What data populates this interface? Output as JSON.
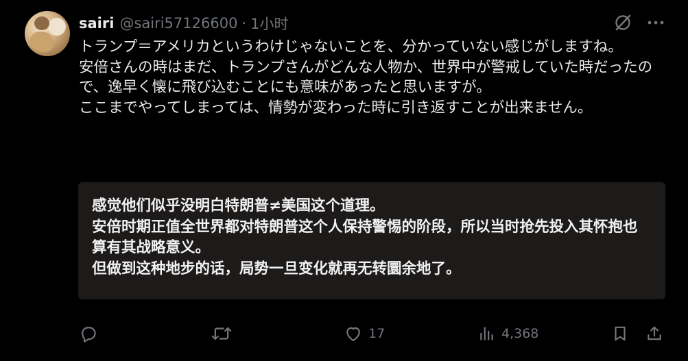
{
  "post": {
    "display_name": "sairi",
    "handle": "@sairi57126600",
    "separator": "·",
    "time": "1小时",
    "lines": [
      "トランプ＝アメリカというわけじゃないことを、分かっていない感じがしますね。",
      "安倍さんの時はまだ、トランプさんがどんな人物か、世界中が警戒していた時だったので、逸早く懐に飛び込むことにも意味があったと思いますが。",
      "ここまでやってしまっては、情勢が変わった時に引き返すことが出来ません。"
    ],
    "translation_lines": [
      "感觉他们似乎没明白特朗普≠美国这个道理。",
      "安倍时期正值全世界都对特朗普这个人保持警惕的阶段，所以当时抢先投入其怀抱也算有其战略意义。",
      "但做到这种地步的话，局势一旦变化就再无转圜余地了。"
    ]
  },
  "actions": {
    "reply_count": "",
    "repost_count": "",
    "like_count": "17",
    "views_count": "4,368"
  },
  "icons": {
    "top": [
      "grok-icon",
      "more-icon"
    ],
    "actions": [
      "reply-icon",
      "repost-icon",
      "like-icon",
      "views-icon",
      "bookmark-icon",
      "share-icon"
    ]
  },
  "colors": {
    "background": "#000000",
    "text": "#e7e9ea",
    "muted": "#71767b",
    "translation_bg": "#1d1a1a"
  }
}
